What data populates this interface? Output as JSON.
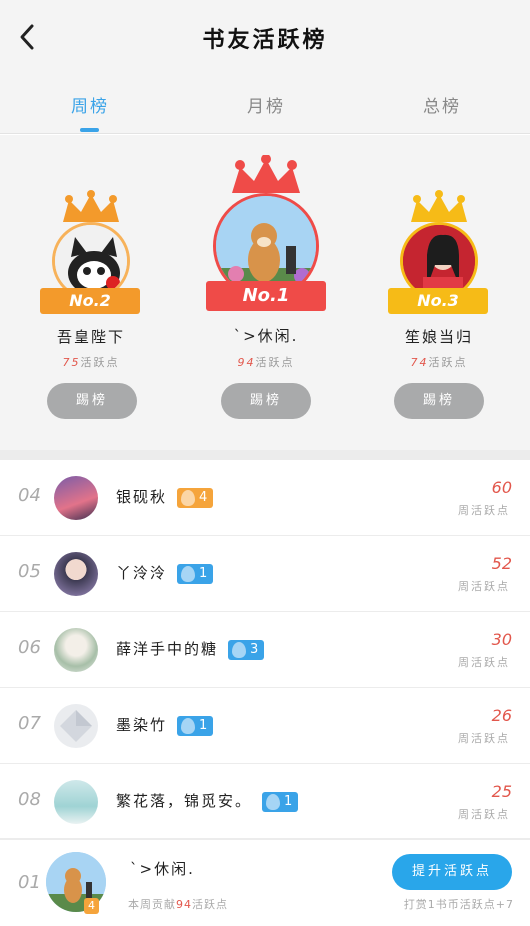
{
  "header": {
    "title": "书友活跃榜",
    "back_icon": "chevron-left-icon"
  },
  "tabs": [
    {
      "label": "周榜",
      "active": true
    },
    {
      "label": "月榜",
      "active": false
    },
    {
      "label": "总榜",
      "active": false
    }
  ],
  "podium": {
    "first": {
      "rank_label": "No.1",
      "name": "ˋ>休闲.",
      "score": "94",
      "score_unit": "活跃点",
      "button": "踢榜"
    },
    "second": {
      "rank_label": "No.2",
      "name": "吾皇陛下",
      "score": "75",
      "score_unit": "活跃点",
      "button": "踢榜"
    },
    "third": {
      "rank_label": "No.3",
      "name": "笙娘当归",
      "score": "74",
      "score_unit": "活跃点",
      "button": "踢榜"
    }
  },
  "list": [
    {
      "rank": "04",
      "name": "银砚秋",
      "badge": "4",
      "badge_color": "orange",
      "score": "60",
      "label": "周活跃点"
    },
    {
      "rank": "05",
      "name": "丫泠泠",
      "badge": "1",
      "badge_color": "blue",
      "score": "52",
      "label": "周活跃点"
    },
    {
      "rank": "06",
      "name": "薛洋手中的糖",
      "badge": "3",
      "badge_color": "blue",
      "score": "30",
      "label": "周活跃点"
    },
    {
      "rank": "07",
      "name": "墨染竹",
      "badge": "1",
      "badge_color": "blue",
      "score": "26",
      "label": "周活跃点"
    },
    {
      "rank": "08",
      "name": "繁花落，锦觅安。",
      "badge": "1",
      "badge_color": "blue",
      "score": "25",
      "label": "周活跃点"
    }
  ],
  "me": {
    "rank": "01",
    "name": "ˋ>休闲.",
    "badge": "4",
    "note_prefix": "本周贡献",
    "note_score": "94",
    "note_suffix": "活跃点",
    "button": "提升活跃点",
    "boost_note": "打赏1书币活跃点+7"
  },
  "colors": {
    "accent": "#3aa3e8",
    "score_red": "#e2574c",
    "badge_orange": "#f5a43b",
    "kick_gray": "#a9aaab"
  }
}
